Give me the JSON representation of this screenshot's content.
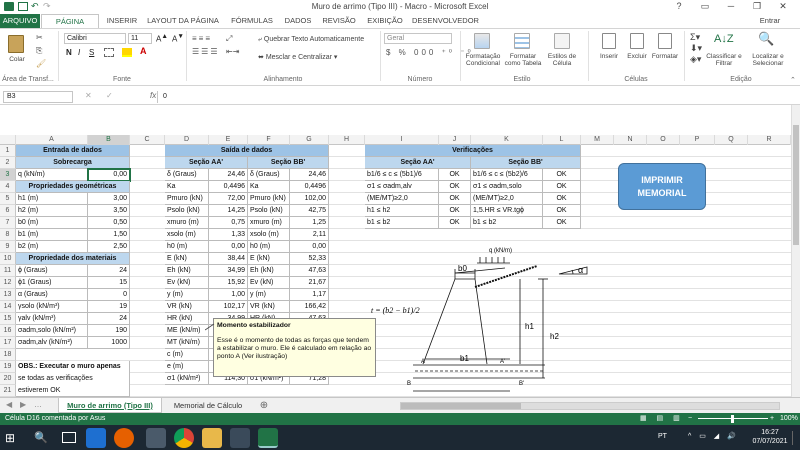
{
  "window": {
    "title": "Muro de arrimo (Tipo III) - Macro - Microsoft Excel",
    "user": "Entrar",
    "help": "?"
  },
  "tabs": [
    "ARQUIVO",
    "PÁGINA INICIAL",
    "INSERIR",
    "LAYOUT DA PÁGINA",
    "FÓRMULAS",
    "DADOS",
    "REVISÃO",
    "EXIBIÇÃO",
    "DESENVOLVEDOR"
  ],
  "ribbon": {
    "paste": "Colar",
    "font_name": "Calibri",
    "font_size": "11",
    "bold": "N",
    "italic": "I",
    "underline": "S",
    "wrap": "Quebrar Texto Automaticamente",
    "merge": "Mesclar e Centralizar",
    "number_format": "Geral",
    "cond_format": "Formatação Condicional",
    "format_table": "Formatar como Tabela",
    "cell_styles": "Estilos de Célula",
    "insert": "Inserir",
    "delete": "Excluir",
    "format": "Formatar",
    "sort": "Classificar e Filtrar",
    "find": "Localizar e Selecionar",
    "groups": {
      "clipboard": "Área de Transf...",
      "font": "Fonte",
      "alignment": "Alinhamento",
      "number": "Número",
      "styles": "Estilo",
      "cells": "Células",
      "editing": "Edição"
    }
  },
  "formula_bar": {
    "name_box": "B3",
    "fx": "fx",
    "value": "0"
  },
  "columns": [
    "A",
    "B",
    "C",
    "D",
    "E",
    "F",
    "G",
    "H",
    "I",
    "J",
    "K",
    "L",
    "M",
    "N",
    "O",
    "P",
    "Q",
    "R"
  ],
  "rows": [
    "1",
    "2",
    "3",
    "4",
    "5",
    "6",
    "7",
    "8",
    "9",
    "10",
    "11",
    "12",
    "13",
    "14",
    "15",
    "16",
    "17",
    "18",
    "19",
    "20",
    "21"
  ],
  "entrada": {
    "title": "Entrada de dados",
    "sobrecarga": "Sobrecarga",
    "q_label": "q (kN/m)",
    "q_val": "0,00",
    "prop_geo": "Propriedades geométricas",
    "geo": [
      [
        "h1 (m)",
        "3,00"
      ],
      [
        "h2 (m)",
        "3,50"
      ],
      [
        "b0 (m)",
        "0,50"
      ],
      [
        "b1 (m)",
        "1,50"
      ],
      [
        "b2 (m)",
        "2,50"
      ]
    ],
    "prop_mat": "Propriedade dos materiais",
    "mat": [
      [
        "ϕ (Graus)",
        "24"
      ],
      [
        "ϕ1 (Graus)",
        "15"
      ],
      [
        "α (Graus)",
        "0"
      ],
      [
        "γsolo (kN/m³)",
        "19"
      ],
      [
        "γalv (kN/m³)",
        "24"
      ],
      [
        "σadm,solo (kN/m²)",
        "190"
      ],
      [
        "σadm,alv (kN/m²)",
        "1000"
      ]
    ],
    "obs": [
      "OBS.: Executar o muro apenas",
      "se todas as verificações",
      "estiverem OK"
    ]
  },
  "saida": {
    "title": "Saída de dados",
    "secA": "Seção AA'",
    "secB": "Seção BB'",
    "rows": [
      [
        "δ (Graus)",
        "24,46",
        "δ (Graus)",
        "24,46"
      ],
      [
        "Ka",
        "0,4496",
        "Ka",
        "0,4496"
      ],
      [
        "Pmuro (kN)",
        "72,00",
        "Pmuro (kN)",
        "102,00"
      ],
      [
        "Psolo (kN)",
        "14,25",
        "Psolo (kN)",
        "42,75"
      ],
      [
        "xmuro (m)",
        "0,75",
        "xmuro (m)",
        "1,25"
      ],
      [
        "xsolo (m)",
        "1,33",
        "xsolo (m)",
        "2,11"
      ],
      [
        "h0 (m)",
        "0,00",
        "h0 (m)",
        "0,00"
      ],
      [
        "E (kN)",
        "38,44",
        "E (kN)",
        "52,33"
      ],
      [
        "Eh (kN)",
        "34,99",
        "Eh (kN)",
        "47,63"
      ],
      [
        "Ev (kN)",
        "15,92",
        "Ev (kN)",
        "21,67"
      ],
      [
        "y (m)",
        "1,00",
        "y (m)",
        "1,17"
      ],
      [
        "VR (kN)",
        "102,17",
        "VR (kN)",
        "166,42"
      ],
      [
        "HR (kN)",
        "34,99",
        "HR (kN)",
        "47,63"
      ],
      [
        "ME (kN/m)",
        "",
        "",
        ""
      ],
      [
        "MT (kN/m)",
        "",
        "",
        ""
      ],
      [
        "c (m)",
        "",
        "",
        ""
      ],
      [
        "e (m)",
        "",
        "",
        ""
      ],
      [
        "σ1 (kN/m²)",
        "114,30",
        "σ1 (kN/m²)",
        "71,28"
      ]
    ]
  },
  "verif": {
    "title": "Verificações",
    "secA": "Seção AA'",
    "secB": "Seção BB'",
    "rows": [
      [
        "b1/6 ≤ c ≤ (5b1)/6",
        "OK",
        "b1/6 ≤ c ≤ (5b2)/6",
        "OK"
      ],
      [
        "σ1 ≤ σadm,alv",
        "OK",
        "σ1 ≤ σadm,solo",
        "OK"
      ],
      [
        "(MΕ/MT)≥2,0",
        "OK",
        "(MΕ/MT)≥2,0",
        "OK"
      ],
      [
        "h1 ≤ h2",
        "OK",
        "1,5.HR ≤ VR.tgϕ",
        "OK"
      ],
      [
        "b1 ≤ b2",
        "OK",
        "b1 ≤ b2",
        "OK"
      ]
    ]
  },
  "print_button": "IMPRIMIR MEMORIAL",
  "comment": {
    "title": "Momento estabilizador",
    "body": "Esse é o momento de todas as forças que tendem a estabilizar o muro. Ele é calculado em relação ao ponto A (Ver ilustração)"
  },
  "diagram": {
    "q": "q (kN/m)",
    "alpha": "α",
    "b0": "b0",
    "b1": "b1",
    "h1": "h1",
    "h2": "h2",
    "A": "A",
    "A2": "A'",
    "B": "B",
    "B2": "B'",
    "formula": "t = (b2 − b1)/2"
  },
  "sheets": [
    "Muro de arrimo (Tipo III)",
    "Memorial de Cálculo"
  ],
  "status": {
    "text": "Célula D16 comentada por Asus",
    "zoom": "100%"
  },
  "taskbar": {
    "lang": "PT",
    "time": "16:27",
    "date": "07/07/2021"
  }
}
